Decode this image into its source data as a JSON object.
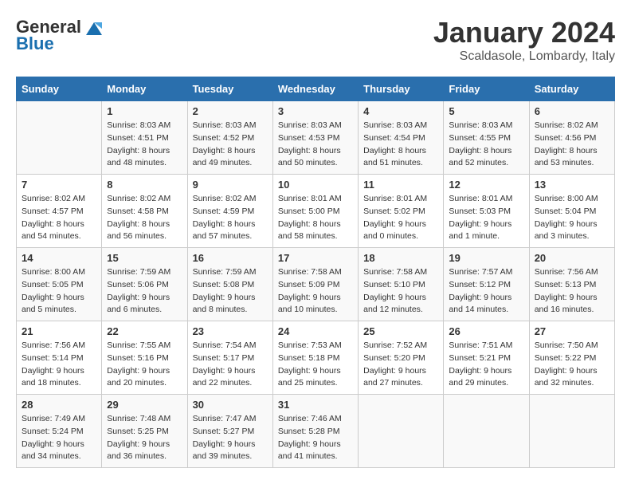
{
  "header": {
    "logo_general": "General",
    "logo_blue": "Blue",
    "title": "January 2024",
    "subtitle": "Scaldasole, Lombardy, Italy"
  },
  "weekdays": [
    "Sunday",
    "Monday",
    "Tuesday",
    "Wednesday",
    "Thursday",
    "Friday",
    "Saturday"
  ],
  "weeks": [
    [
      {
        "day": "",
        "sunrise": "",
        "sunset": "",
        "daylight": ""
      },
      {
        "day": "1",
        "sunrise": "Sunrise: 8:03 AM",
        "sunset": "Sunset: 4:51 PM",
        "daylight": "Daylight: 8 hours and 48 minutes."
      },
      {
        "day": "2",
        "sunrise": "Sunrise: 8:03 AM",
        "sunset": "Sunset: 4:52 PM",
        "daylight": "Daylight: 8 hours and 49 minutes."
      },
      {
        "day": "3",
        "sunrise": "Sunrise: 8:03 AM",
        "sunset": "Sunset: 4:53 PM",
        "daylight": "Daylight: 8 hours and 50 minutes."
      },
      {
        "day": "4",
        "sunrise": "Sunrise: 8:03 AM",
        "sunset": "Sunset: 4:54 PM",
        "daylight": "Daylight: 8 hours and 51 minutes."
      },
      {
        "day": "5",
        "sunrise": "Sunrise: 8:03 AM",
        "sunset": "Sunset: 4:55 PM",
        "daylight": "Daylight: 8 hours and 52 minutes."
      },
      {
        "day": "6",
        "sunrise": "Sunrise: 8:02 AM",
        "sunset": "Sunset: 4:56 PM",
        "daylight": "Daylight: 8 hours and 53 minutes."
      }
    ],
    [
      {
        "day": "7",
        "sunrise": "Sunrise: 8:02 AM",
        "sunset": "Sunset: 4:57 PM",
        "daylight": "Daylight: 8 hours and 54 minutes."
      },
      {
        "day": "8",
        "sunrise": "Sunrise: 8:02 AM",
        "sunset": "Sunset: 4:58 PM",
        "daylight": "Daylight: 8 hours and 56 minutes."
      },
      {
        "day": "9",
        "sunrise": "Sunrise: 8:02 AM",
        "sunset": "Sunset: 4:59 PM",
        "daylight": "Daylight: 8 hours and 57 minutes."
      },
      {
        "day": "10",
        "sunrise": "Sunrise: 8:01 AM",
        "sunset": "Sunset: 5:00 PM",
        "daylight": "Daylight: 8 hours and 58 minutes."
      },
      {
        "day": "11",
        "sunrise": "Sunrise: 8:01 AM",
        "sunset": "Sunset: 5:02 PM",
        "daylight": "Daylight: 9 hours and 0 minutes."
      },
      {
        "day": "12",
        "sunrise": "Sunrise: 8:01 AM",
        "sunset": "Sunset: 5:03 PM",
        "daylight": "Daylight: 9 hours and 1 minute."
      },
      {
        "day": "13",
        "sunrise": "Sunrise: 8:00 AM",
        "sunset": "Sunset: 5:04 PM",
        "daylight": "Daylight: 9 hours and 3 minutes."
      }
    ],
    [
      {
        "day": "14",
        "sunrise": "Sunrise: 8:00 AM",
        "sunset": "Sunset: 5:05 PM",
        "daylight": "Daylight: 9 hours and 5 minutes."
      },
      {
        "day": "15",
        "sunrise": "Sunrise: 7:59 AM",
        "sunset": "Sunset: 5:06 PM",
        "daylight": "Daylight: 9 hours and 6 minutes."
      },
      {
        "day": "16",
        "sunrise": "Sunrise: 7:59 AM",
        "sunset": "Sunset: 5:08 PM",
        "daylight": "Daylight: 9 hours and 8 minutes."
      },
      {
        "day": "17",
        "sunrise": "Sunrise: 7:58 AM",
        "sunset": "Sunset: 5:09 PM",
        "daylight": "Daylight: 9 hours and 10 minutes."
      },
      {
        "day": "18",
        "sunrise": "Sunrise: 7:58 AM",
        "sunset": "Sunset: 5:10 PM",
        "daylight": "Daylight: 9 hours and 12 minutes."
      },
      {
        "day": "19",
        "sunrise": "Sunrise: 7:57 AM",
        "sunset": "Sunset: 5:12 PM",
        "daylight": "Daylight: 9 hours and 14 minutes."
      },
      {
        "day": "20",
        "sunrise": "Sunrise: 7:56 AM",
        "sunset": "Sunset: 5:13 PM",
        "daylight": "Daylight: 9 hours and 16 minutes."
      }
    ],
    [
      {
        "day": "21",
        "sunrise": "Sunrise: 7:56 AM",
        "sunset": "Sunset: 5:14 PM",
        "daylight": "Daylight: 9 hours and 18 minutes."
      },
      {
        "day": "22",
        "sunrise": "Sunrise: 7:55 AM",
        "sunset": "Sunset: 5:16 PM",
        "daylight": "Daylight: 9 hours and 20 minutes."
      },
      {
        "day": "23",
        "sunrise": "Sunrise: 7:54 AM",
        "sunset": "Sunset: 5:17 PM",
        "daylight": "Daylight: 9 hours and 22 minutes."
      },
      {
        "day": "24",
        "sunrise": "Sunrise: 7:53 AM",
        "sunset": "Sunset: 5:18 PM",
        "daylight": "Daylight: 9 hours and 25 minutes."
      },
      {
        "day": "25",
        "sunrise": "Sunrise: 7:52 AM",
        "sunset": "Sunset: 5:20 PM",
        "daylight": "Daylight: 9 hours and 27 minutes."
      },
      {
        "day": "26",
        "sunrise": "Sunrise: 7:51 AM",
        "sunset": "Sunset: 5:21 PM",
        "daylight": "Daylight: 9 hours and 29 minutes."
      },
      {
        "day": "27",
        "sunrise": "Sunrise: 7:50 AM",
        "sunset": "Sunset: 5:22 PM",
        "daylight": "Daylight: 9 hours and 32 minutes."
      }
    ],
    [
      {
        "day": "28",
        "sunrise": "Sunrise: 7:49 AM",
        "sunset": "Sunset: 5:24 PM",
        "daylight": "Daylight: 9 hours and 34 minutes."
      },
      {
        "day": "29",
        "sunrise": "Sunrise: 7:48 AM",
        "sunset": "Sunset: 5:25 PM",
        "daylight": "Daylight: 9 hours and 36 minutes."
      },
      {
        "day": "30",
        "sunrise": "Sunrise: 7:47 AM",
        "sunset": "Sunset: 5:27 PM",
        "daylight": "Daylight: 9 hours and 39 minutes."
      },
      {
        "day": "31",
        "sunrise": "Sunrise: 7:46 AM",
        "sunset": "Sunset: 5:28 PM",
        "daylight": "Daylight: 9 hours and 41 minutes."
      },
      {
        "day": "",
        "sunrise": "",
        "sunset": "",
        "daylight": ""
      },
      {
        "day": "",
        "sunrise": "",
        "sunset": "",
        "daylight": ""
      },
      {
        "day": "",
        "sunrise": "",
        "sunset": "",
        "daylight": ""
      }
    ]
  ]
}
